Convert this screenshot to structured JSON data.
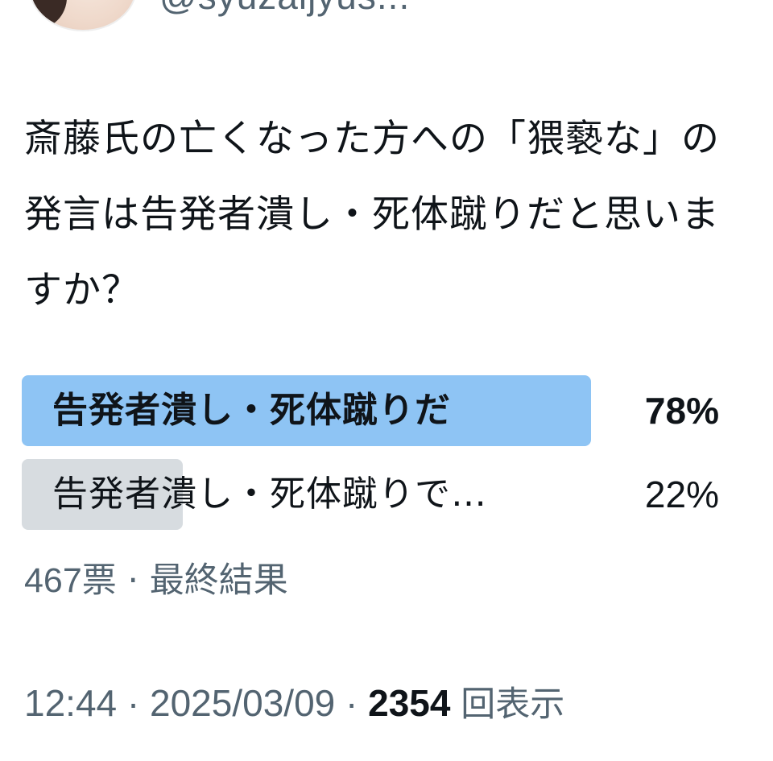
{
  "header": {
    "handle": "@syuzaijyus..."
  },
  "tweet": {
    "text": "斎藤氏の亡くなった方への「猥褻な」の発言は告発者潰し・死体蹴りだと思いますか？"
  },
  "poll": {
    "options": [
      {
        "label": "告発者潰し・死体蹴りだ",
        "percent": "78%",
        "share": 0.78,
        "winner": true
      },
      {
        "label": "告発者潰し・死体蹴りで…",
        "percent": "22%",
        "share": 0.22,
        "winner": false
      }
    ],
    "votes": "467",
    "votes_unit": "票",
    "status": "最終結果"
  },
  "footer": {
    "time": "12:44",
    "date": "2025/03/09",
    "views": "2354",
    "views_label": "回表示"
  },
  "colors": {
    "winner_bar": "#8ec4f4",
    "loser_bar": "#d7dce0",
    "secondary_text": "#536471",
    "primary_text": "#0f1419"
  }
}
